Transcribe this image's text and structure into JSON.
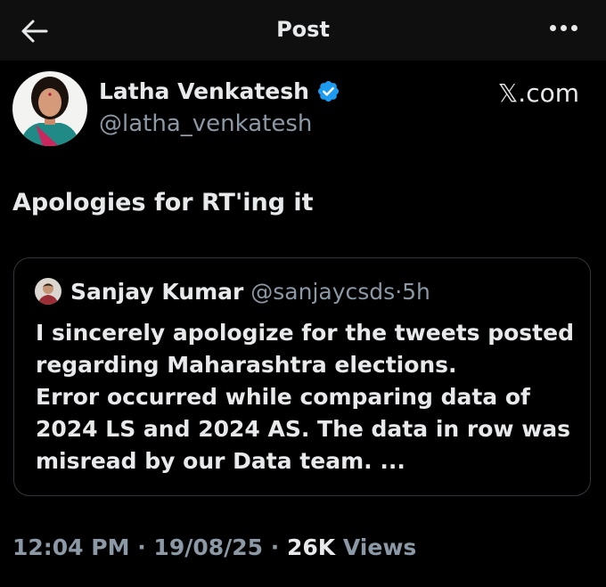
{
  "header": {
    "title": "Post",
    "back_icon": "arrow-left-icon",
    "more_icon": "more-horizontal-icon"
  },
  "author": {
    "name": "Latha Venkatesh",
    "handle": "@latha_venkatesh",
    "verified_icon": "verified-badge-icon",
    "verified_color": "#1d9bf0"
  },
  "watermark": "𝕏.com",
  "post": {
    "text": "Apologies for RT'ing it"
  },
  "quoted": {
    "name": "Sanjay Kumar",
    "handle": "@sanjaycsds",
    "separator": "·",
    "time": "5h",
    "lines": [
      "I sincerely apologize for the tweets posted",
      "regarding Maharashtra elections.",
      "Error occurred while comparing data of",
      "2024 LS and 2024 AS. The data in row was",
      "misread by our Data team. ..."
    ]
  },
  "meta": {
    "time": "12:04 PM",
    "sep1": "·",
    "date": "19/08/25",
    "sep2": "·",
    "views_count": "26K",
    "views_label": "Views"
  }
}
